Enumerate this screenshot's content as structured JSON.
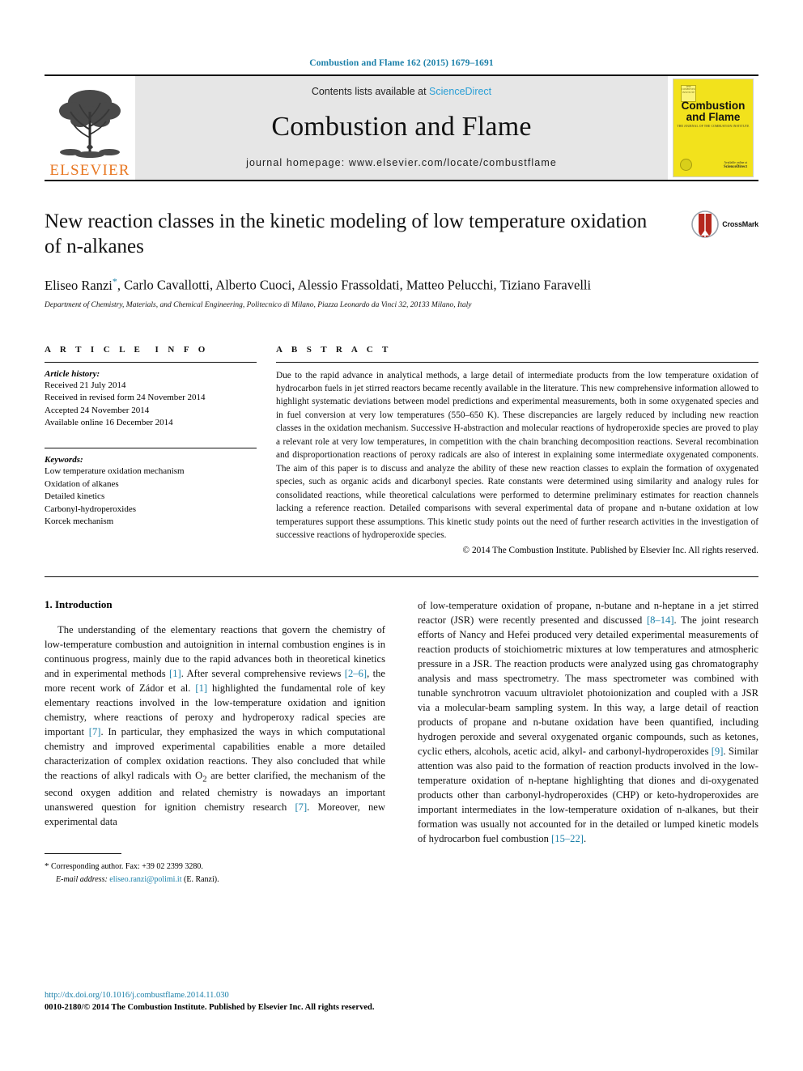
{
  "running_head": "Combustion and Flame 162 (2015) 1679–1691",
  "masthead": {
    "publisher_name": "ELSEVIER",
    "contents_prefix": "Contents lists available at ",
    "contents_link": "ScienceDirect",
    "journal_title": "Combustion and Flame",
    "homepage": "journal homepage: www.elsevier.com/locate/combustflame",
    "cover": {
      "title_line1": "Combustion",
      "title_line2": "and Flame",
      "subtitle": "THE JOURNAL OF THE COMBUSTION INSTITUTE",
      "badge_text": "THE COMBUSTION INSTITUTE",
      "footer_line1": "Available online at",
      "footer_line2": "ScienceDirect"
    }
  },
  "article": {
    "title": "New reaction classes in the kinetic modeling of low temperature oxidation of n-alkanes",
    "crossmark_label": "CrossMark",
    "authors_html": "Eliseo Ranzi <sup>*</sup>, Carlo Cavallotti, Alberto Cuoci, Alessio Frassoldati, Matteo Pelucchi, Tiziano Faravelli",
    "authors_plain": "Eliseo Ranzi *, Carlo Cavallotti, Alberto Cuoci, Alessio Frassoldati, Matteo Pelucchi, Tiziano Faravelli",
    "affiliation": "Department of Chemistry, Materials, and Chemical Engineering, Politecnico di Milano, Piazza Leonardo da Vinci 32, 20133 Milano, Italy"
  },
  "article_info": {
    "heading": "A R T I C L E  I N F O",
    "history_label": "Article history:",
    "history": [
      "Received 21 July 2014",
      "Received in revised form 24 November 2014",
      "Accepted 24 November 2014",
      "Available online 16 December 2014"
    ],
    "keywords_label": "Keywords:",
    "keywords": [
      "Low temperature oxidation mechanism",
      "Oxidation of alkanes",
      "Detailed kinetics",
      "Carbonyl-hydroperoxides",
      "Korcek mechanism"
    ]
  },
  "abstract": {
    "heading": "A B S T R A C T",
    "text": "Due to the rapid advance in analytical methods, a large detail of intermediate products from the low temperature oxidation of hydrocarbon fuels in jet stirred reactors became recently available in the literature. This new comprehensive information allowed to highlight systematic deviations between model predictions and experimental measurements, both in some oxygenated species and in fuel conversion at very low temperatures (550–650 K). These discrepancies are largely reduced by including new reaction classes in the oxidation mechanism. Successive H-abstraction and molecular reactions of hydroperoxide species are proved to play a relevant role at very low temperatures, in competition with the chain branching decomposition reactions. Several recombination and disproportionation reactions of peroxy radicals are also of interest in explaining some intermediate oxygenated components. The aim of this paper is to discuss and analyze the ability of these new reaction classes to explain the formation of oxygenated species, such as organic acids and dicarbonyl species. Rate constants were determined using similarity and analogy rules for consolidated reactions, while theoretical calculations were performed to determine preliminary estimates for reaction channels lacking a reference reaction. Detailed comparisons with several experimental data of propane and n-butane oxidation at low temperatures support these assumptions. This kinetic study points out the need of further research activities in the investigation of successive reactions of hydroperoxide species.",
    "copyright": "© 2014 The Combustion Institute. Published by Elsevier Inc. All rights reserved."
  },
  "introduction": {
    "heading": "1. Introduction",
    "left_paragraph_parts": {
      "p1a": "The understanding of the elementary reactions that govern the chemistry of low-temperature combustion and autoignition in internal combustion engines is in continuous progress, mainly due to the rapid advances both in theoretical kinetics and in experimental methods ",
      "ref1": "[1]",
      "p1b": ". After several comprehensive reviews ",
      "ref2": "[2–6]",
      "p1c": ", the more recent work of Zádor et al. ",
      "ref3": "[1]",
      "p1d": " highlighted the fundamental role of key elementary reactions involved in the low-temperature oxidation and ignition chemistry, where reactions of peroxy and hydroperoxy radical species are important ",
      "ref4": "[7]",
      "p1e": ". In particular, they emphasized the ways in which computational chemistry and improved experimental capabilities enable a more detailed characterization of complex oxidation reactions. They also concluded that while the reactions of alkyl radicals with O",
      "sub2": "2",
      "p1f": " are better clarified, the mechanism of the second oxygen addition and related chemistry is nowadays an important unanswered question for ignition chemistry research ",
      "ref5": "[7]",
      "p1g": ". Moreover, new experimental data"
    },
    "right_paragraph_parts": {
      "p2a": "of low-temperature oxidation of propane, n-butane and n-heptane in a jet stirred reactor (JSR) were recently presented and discussed ",
      "ref6": "[8–14]",
      "p2b": ". The joint research efforts of Nancy and Hefei produced very detailed experimental measurements of reaction products of stoichiometric mixtures at low temperatures and atmospheric pressure in a JSR. The reaction products were analyzed using gas chromatography analysis and mass spectrometry. The mass spectrometer was combined with tunable synchrotron vacuum ultraviolet photoionization and coupled with a JSR via a molecular-beam sampling system. In this way, a large detail of reaction products of propane and n-butane oxidation have been quantified, including hydrogen peroxide and several oxygenated organic compounds, such as ketones, cyclic ethers, alcohols, acetic acid, alkyl- and carbonyl-hydroperoxides ",
      "ref7": "[9]",
      "p2c": ". Similar attention was also paid to the formation of reaction products involved in the low-temperature oxidation of n-heptane highlighting that diones and di-oxygenated products other than carbonyl-hydroperoxides (CHP) or keto-hydroperoxides are important intermediates in the low-temperature oxidation of n-alkanes, but their formation was usually not accounted for in the detailed or lumped kinetic models of hydrocarbon fuel combustion ",
      "ref8": "[15–22]",
      "p2d": "."
    }
  },
  "footnote": {
    "star": "*",
    "corresponding": "Corresponding author. Fax: +39 02 2399 3280.",
    "email_label": "E-mail address:",
    "email": "eliseo.ranzi@polimi.it",
    "email_suffix": "(E. Ranzi)."
  },
  "page_footer": {
    "doi": "http://dx.doi.org/10.1016/j.combustflame.2014.11.030",
    "issn_line": "0010-2180/© 2014 The Combustion Institute. Published by Elsevier Inc. All rights reserved."
  },
  "colors": {
    "link_blue": "#1a7fa8",
    "sciencedirect_blue": "#2a9fd6",
    "elsevier_orange": "#E87722",
    "cover_yellow": "#f2e21c",
    "crossmark_red": "#b5281e"
  }
}
